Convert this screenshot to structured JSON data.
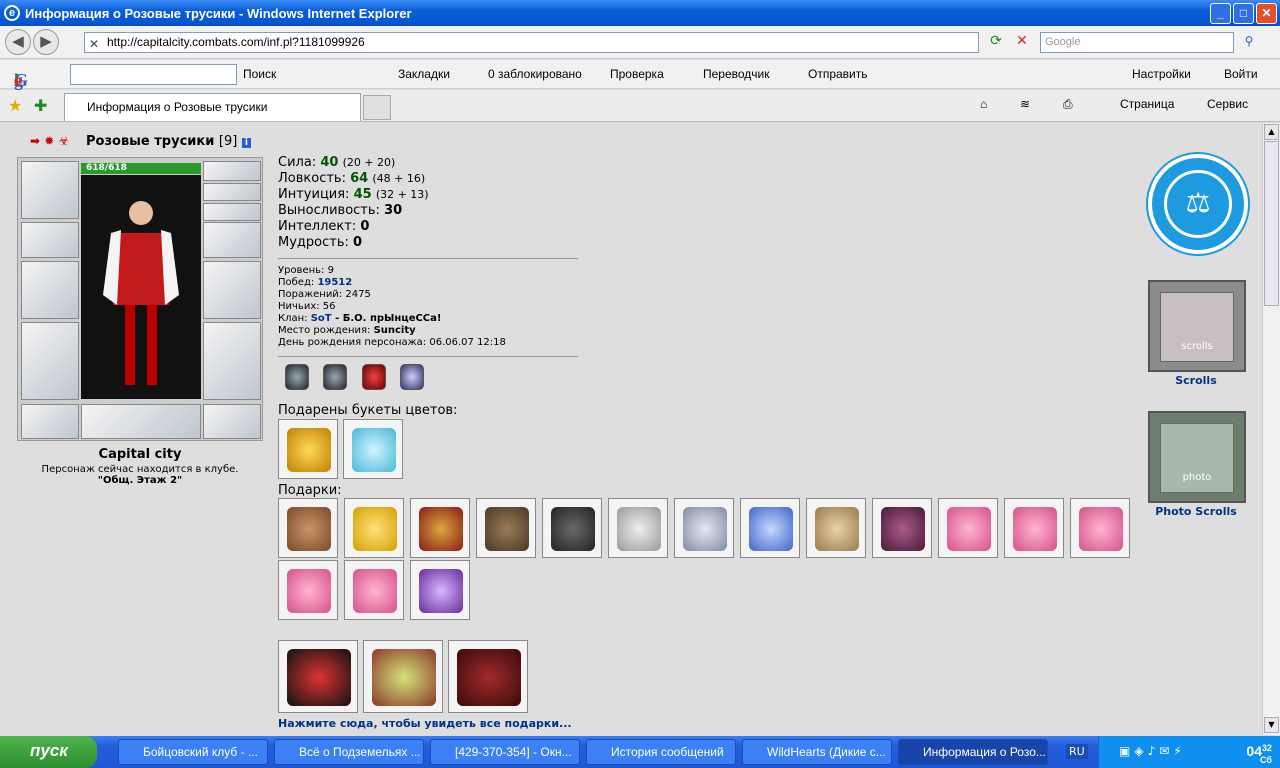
{
  "window": {
    "title": "Информация о Розовые трусики - Windows Internet Explorer",
    "minimize": "_",
    "maximize": "□",
    "close": "✕"
  },
  "address": {
    "url": "http://capitalcity.combats.com/inf.pl?1181099926",
    "search_placeholder": "Google"
  },
  "google_bar": {
    "logo": "Google",
    "search_label": "Поиск",
    "bookmarks": "Закладки",
    "blocked": "0 заблокировано",
    "check": "Проверка",
    "translator": "Переводчик",
    "send": "Отправить",
    "settings": "Настройки",
    "login": "Войти"
  },
  "tabs": {
    "active": "Информация о Розовые трусики"
  },
  "commands": {
    "page": "Страница",
    "service": "Сервис"
  },
  "character": {
    "name": "Розовые трусики",
    "level": "[9]",
    "hp": "618/618",
    "city": "Capital city",
    "status": "Персонаж сейчас находится в клубе.",
    "location": "\"Общ. Этаж 2\""
  },
  "stats": [
    {
      "label": "Сила:",
      "value": "40",
      "extra": "(20 + 20)"
    },
    {
      "label": "Ловкость:",
      "value": "64",
      "extra": "(48 + 16)"
    },
    {
      "label": "Интуиция:",
      "value": "45",
      "extra": "(32 + 13)"
    },
    {
      "label": "Выносливость:",
      "value": "30",
      "extra": ""
    },
    {
      "label": "Интеллект:",
      "value": "0",
      "extra": ""
    },
    {
      "label": "Мудрость:",
      "value": "0",
      "extra": ""
    }
  ],
  "info": {
    "level": "Уровень: 9",
    "wins_label": "Побед:",
    "wins": "19512",
    "losses": "Поражений: 2475",
    "draws": "Ничьих: 56",
    "clan_label": "Клан:",
    "clan": "SoT",
    "clan_rank": " - Б.О. прЫнцеССа!",
    "birthplace_label": "Место рождения:",
    "birthplace": "Suncity",
    "birthday": "День рождения персонажа: 06.06.07 12:18"
  },
  "sections": {
    "flowers": "Подарены букеты цветов:",
    "gifts": "Подарки:",
    "all_gifts": "Нажмите сюда, чтобы увидеть все подарки..."
  },
  "right": {
    "scrolls": "Scrolls",
    "photo_scrolls": "Photo Scrolls",
    "scrolls_art": "scrolls",
    "photo_art": "photo"
  },
  "taskbar": {
    "start": "пуск",
    "items": [
      "Бойцовский клуб - ...",
      "Всё о Подземельях ...",
      "[429-370-354] - Окн...",
      "История сообщений",
      "WildHearts (Дикие с...",
      "Информация о Розо..."
    ],
    "lang": "RU",
    "time": "04",
    "time_suffix": "32",
    "day": "Сб"
  },
  "colors": {
    "accent": "#1e9be0",
    "link": "#003388",
    "stat_value": "#005500"
  }
}
